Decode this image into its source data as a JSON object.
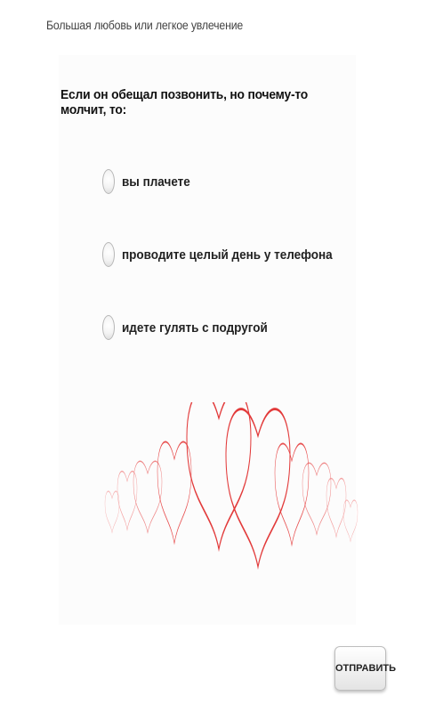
{
  "app": {
    "title": "Большая любовь или легкое увлечение"
  },
  "quiz": {
    "question": "Если он обещал позвонить, но почему-то молчит, то:",
    "options": [
      {
        "label": "вы плачете",
        "selected": false
      },
      {
        "label": "проводите целый день у телефона",
        "selected": false
      },
      {
        "label": "идете гулять с подругой",
        "selected": false
      }
    ],
    "submit_label": "ОТПРАВИТЬ"
  },
  "decoration": {
    "image": "hearts-illustration",
    "colors": [
      "#e23a3a",
      "#f06666",
      "#f4a3a3"
    ]
  }
}
